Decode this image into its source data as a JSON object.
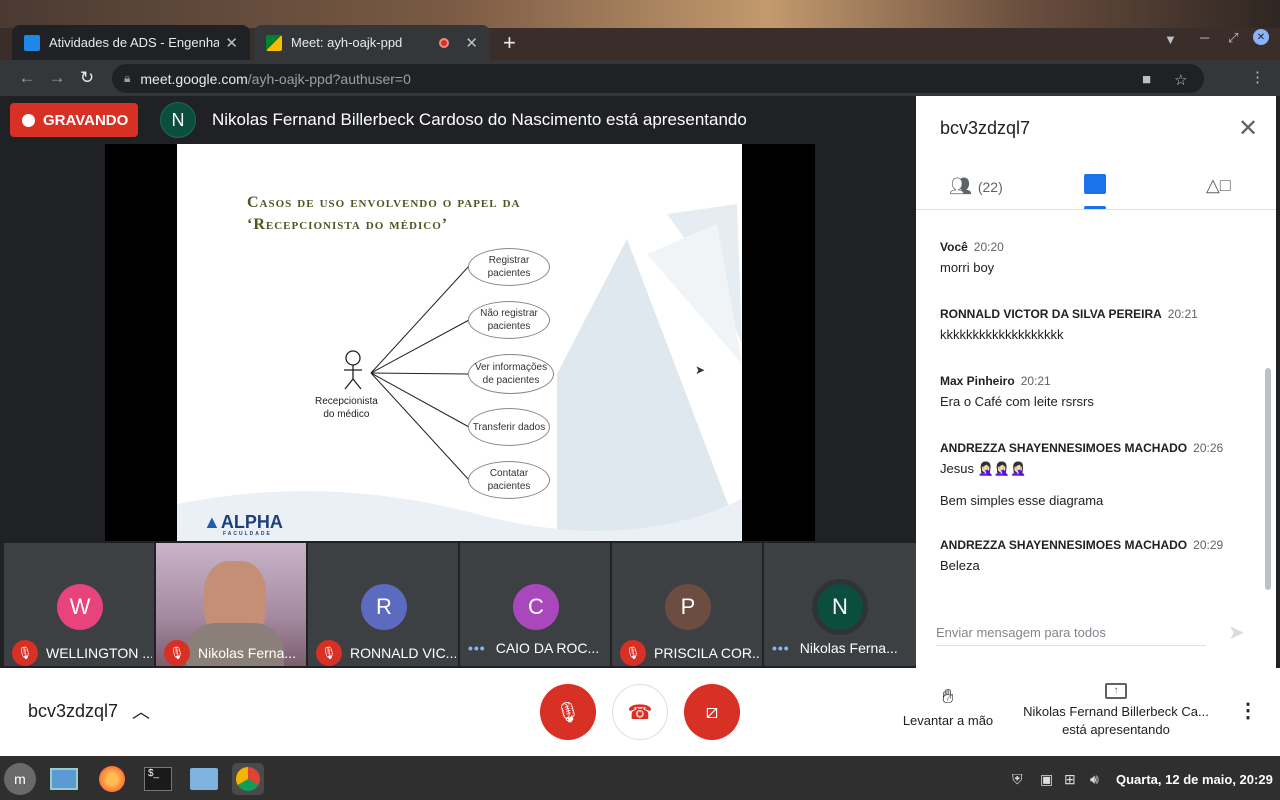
{
  "browser": {
    "tabs": [
      {
        "title": "Atividades de ADS - Engenhar",
        "icon": "classroom-icon"
      },
      {
        "title": "Meet: ayh-oajk-ppd",
        "icon": "meet-icon",
        "recording": true
      }
    ],
    "url_host": "meet.google.com",
    "url_path": "/ayh-oajk-ppd?authuser=0",
    "profile_initial": "C"
  },
  "stage": {
    "recording_label": "GRAVANDO",
    "presenter_initial": "N",
    "presenter_text": "Nikolas Fernand Billerbeck Cardoso do Nascimento está apresentando",
    "slide": {
      "title_line1": "Casos de uso envolvendo o papel da",
      "title_line2": "‘Recepcionista do médico’",
      "actor_line1": "Recepcionista",
      "actor_line2": "do médico",
      "use_cases": [
        {
          "line1": "Registrar",
          "line2": "pacientes"
        },
        {
          "line1": "Não registrar",
          "line2": "pacientes"
        },
        {
          "line1": "Ver informações",
          "line2": "de pacientes"
        },
        {
          "line1": "Transferir dados",
          "line2": ""
        },
        {
          "line1": "Contatar",
          "line2": "pacientes"
        }
      ],
      "logo": "ALPHA",
      "logo_sub": "FACULDADE"
    }
  },
  "participants": [
    {
      "initial": "W",
      "name": "WELLINGTON ...",
      "color": "#e8437a",
      "status": "muted"
    },
    {
      "initial": "",
      "name": "Nikolas Ferna...",
      "color": "#8a6f8a",
      "status": "muted",
      "video": true
    },
    {
      "initial": "R",
      "name": "RONNALD VIC...",
      "color": "#5c6bc0",
      "status": "muted"
    },
    {
      "initial": "C",
      "name": "CAIO DA ROC...",
      "color": "#ab47bc",
      "status": "speaking"
    },
    {
      "initial": "P",
      "name": "PRISCILA COR...",
      "color": "#6d4c41",
      "status": "muted"
    },
    {
      "initial": "N",
      "name": "Nikolas Ferna...",
      "color": "#0b4d3e",
      "status": "speaking"
    }
  ],
  "panel": {
    "meeting_code": "bcv3zdzql7",
    "people_count": "(22)",
    "messages": [
      {
        "sender": "Você",
        "time": "20:20",
        "lines": [
          "morri boy"
        ]
      },
      {
        "sender": "RONNALD VICTOR DA SILVA PEREIRA",
        "time": "20:21",
        "lines": [
          "kkkkkkkkkkkkkkkkkkk"
        ]
      },
      {
        "sender": "Max Pinheiro",
        "time": "20:21",
        "lines": [
          "Era o Café com leite rsrsrs"
        ]
      },
      {
        "sender": "ANDREZZA SHAYENNESIMOES MACHADO",
        "time": "20:26",
        "lines": [
          "Jesus 🤦🏻‍♀️🤦🏻‍♀️🤦🏻‍♀️",
          "Bem simples esse diagrama"
        ]
      },
      {
        "sender": "ANDREZZA SHAYENNESIMOES MACHADO",
        "time": "20:29",
        "lines": [
          "Beleza"
        ]
      }
    ],
    "compose_placeholder": "Enviar mensagem para todos"
  },
  "controls": {
    "meeting_code": "bcv3zdzql7",
    "raise_hand": "Levantar a mão",
    "presenting_line1": "Nikolas Fernand Billerbeck Ca...",
    "presenting_line2": "está apresentando"
  },
  "taskbar": {
    "clock": "Quarta, 12 de maio, 20:29",
    "apps": [
      "mint-menu-icon",
      "desktop-icon",
      "firefox-icon",
      "terminal-icon",
      "files-icon",
      "chrome-icon"
    ]
  }
}
